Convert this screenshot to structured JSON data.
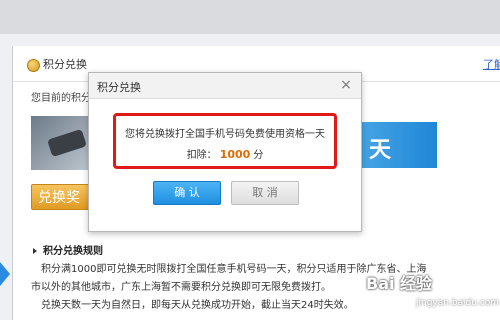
{
  "section": {
    "title": "积分兑换",
    "link": "了解",
    "current_label": "您目前的积分"
  },
  "banner": {
    "right_char": "天"
  },
  "redeem_button": "兑换奖",
  "rules": {
    "title": "积分兑换规则",
    "line1": "积分满1000即可兑换无时限拨打全国任意手机号码一天，积分只适用于除广东省、上海",
    "line2": "市以外的其他城市，广东上海暂不需要积分兑换即可无限免费拨打。",
    "line3": "兑换天数一天为自然日，即每天从兑换成功开始，截止当天24时失效。"
  },
  "dialog": {
    "title": "积分兑换",
    "close": "×",
    "message": "您将兑换拨打全国手机号码免费使用资格一天",
    "cost_prefix": "扣除：",
    "cost_points": "1000",
    "cost_unit": "分",
    "confirm": "确 认",
    "cancel": "取 消"
  },
  "watermark": {
    "logo": "Bai 经验",
    "url": "jingyan.baidu.com"
  }
}
